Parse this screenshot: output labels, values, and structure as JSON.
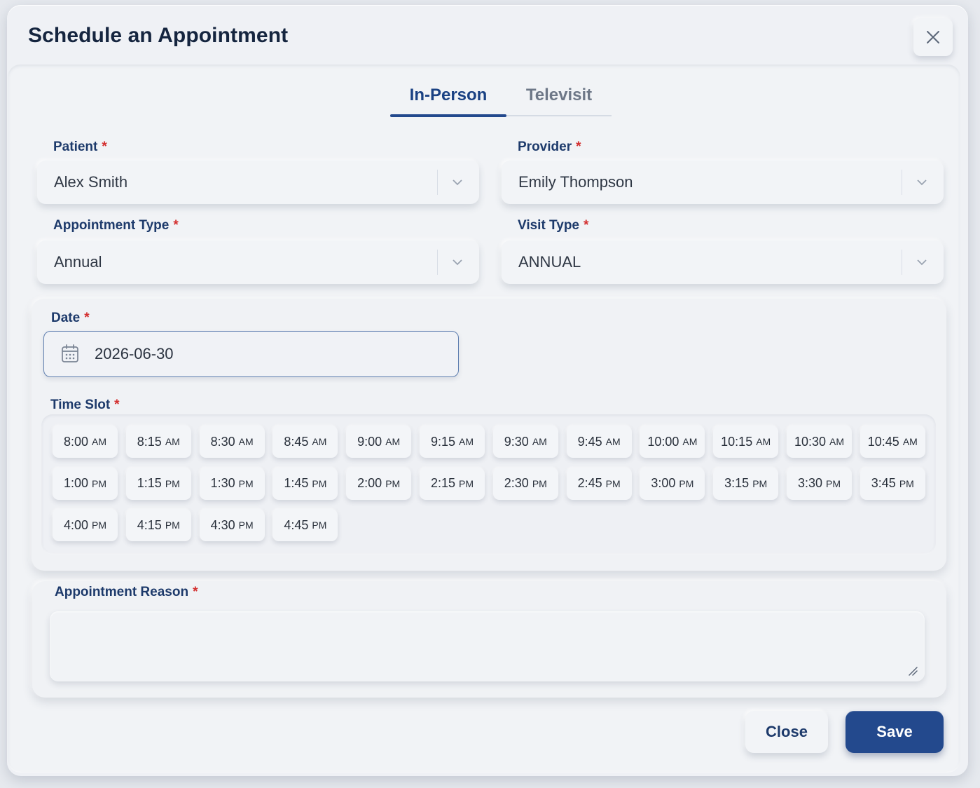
{
  "dialog": {
    "title": "Schedule an Appointment",
    "close_icon": "close-icon"
  },
  "tabs": [
    {
      "label": "In-Person",
      "active": true
    },
    {
      "label": "Televisit",
      "active": false
    }
  ],
  "fields": {
    "patient": {
      "label": "Patient",
      "required": "*",
      "value": "Alex Smith"
    },
    "provider": {
      "label": "Provider",
      "required": "*",
      "value": "Emily Thompson"
    },
    "appointment_type": {
      "label": "Appointment Type",
      "required": "*",
      "value": "Annual"
    },
    "visit_type": {
      "label": "Visit Type",
      "required": "*",
      "value": "ANNUAL"
    },
    "date": {
      "label": "Date",
      "required": "*",
      "value": "2026-06-30"
    },
    "time_slot": {
      "label": "Time Slot",
      "required": "*"
    },
    "reason": {
      "label": "Appointment Reason",
      "required": "*",
      "value": ""
    }
  },
  "time_slots": [
    {
      "time": "8:00",
      "period": "AM"
    },
    {
      "time": "8:15",
      "period": "AM"
    },
    {
      "time": "8:30",
      "period": "AM"
    },
    {
      "time": "8:45",
      "period": "AM"
    },
    {
      "time": "9:00",
      "period": "AM"
    },
    {
      "time": "9:15",
      "period": "AM"
    },
    {
      "time": "9:30",
      "period": "AM"
    },
    {
      "time": "9:45",
      "period": "AM"
    },
    {
      "time": "10:00",
      "period": "AM"
    },
    {
      "time": "10:15",
      "period": "AM"
    },
    {
      "time": "10:30",
      "period": "AM"
    },
    {
      "time": "10:45",
      "period": "AM"
    },
    {
      "time": "1:00",
      "period": "PM"
    },
    {
      "time": "1:15",
      "period": "PM"
    },
    {
      "time": "1:30",
      "period": "PM"
    },
    {
      "time": "1:45",
      "period": "PM"
    },
    {
      "time": "2:00",
      "period": "PM"
    },
    {
      "time": "2:15",
      "period": "PM"
    },
    {
      "time": "2:30",
      "period": "PM"
    },
    {
      "time": "2:45",
      "period": "PM"
    },
    {
      "time": "3:00",
      "period": "PM"
    },
    {
      "time": "3:15",
      "period": "PM"
    },
    {
      "time": "3:30",
      "period": "PM"
    },
    {
      "time": "3:45",
      "period": "PM"
    },
    {
      "time": "4:00",
      "period": "PM"
    },
    {
      "time": "4:15",
      "period": "PM"
    },
    {
      "time": "4:30",
      "period": "PM"
    },
    {
      "time": "4:45",
      "period": "PM"
    }
  ],
  "buttons": {
    "close": "Close",
    "save": "Save"
  },
  "colors": {
    "accent": "#23498d",
    "required": "#d32f2f",
    "label": "#1d3a6b"
  }
}
